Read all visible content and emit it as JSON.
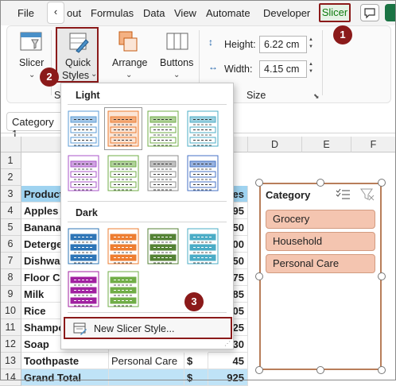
{
  "menu": {
    "file": "File",
    "back": "‹",
    "partial_tab": "out",
    "formulas": "Formulas",
    "data": "Data",
    "view": "View",
    "automate": "Automate",
    "developer": "Developer",
    "slicer": "Slicer"
  },
  "ribbon": {
    "slicer_label": "Slicer",
    "quick_styles_line1": "Quick",
    "quick_styles_line2": "Styles",
    "arrange_label": "Arrange",
    "buttons_label": "Buttons",
    "height_label": "Height:",
    "height_value": "6.22 cm",
    "width_label": "Width:",
    "width_value": "4.15 cm",
    "size_group": "Size",
    "group_partial": "S"
  },
  "callouts": [
    "1",
    "2",
    "3"
  ],
  "namebox": "Category 1",
  "columns": [
    "D",
    "E",
    "F"
  ],
  "rows": [
    "1",
    "2",
    "3",
    "4",
    "5",
    "6",
    "7",
    "8",
    "9",
    "10",
    "11",
    "12",
    "13",
    "14"
  ],
  "sheet": {
    "header": "Product",
    "header_right": "les",
    "cells": [
      {
        "row": "4",
        "a": "Apples",
        "v": "95"
      },
      {
        "row": "5",
        "a": "Bananas",
        "v": "50"
      },
      {
        "row": "6",
        "a": "Deterge",
        "v": "00"
      },
      {
        "row": "7",
        "a": "Dishwas",
        "v": "50"
      },
      {
        "row": "8",
        "a": "Floor Cl",
        "v": "75"
      },
      {
        "row": "9",
        "a": "Milk",
        "v": "85"
      },
      {
        "row": "10",
        "a": "Rice",
        "v": "05"
      },
      {
        "row": "11",
        "a": "Shampo",
        "v": "25"
      },
      {
        "row": "12",
        "a": "Soap",
        "v": "30"
      },
      {
        "row": "13",
        "a": "Toothpaste",
        "b": "Personal Care",
        "c": "$",
        "v": "45"
      }
    ],
    "total_label": "Grand Total",
    "total_currency": "$",
    "total_value": "925"
  },
  "dropdown": {
    "light_label": "Light",
    "dark_label": "Dark",
    "new_style_label": "New Slicer Style...",
    "light_colors": [
      "#5b9bd5",
      "#ed7d31",
      "#70ad47",
      "#4bacc6",
      "#a855c8",
      "#70ad47",
      "#8c8c8c",
      "#4472c4"
    ],
    "dark_colors": [
      "#2e75b6",
      "#ed7d31",
      "#548235",
      "#4bacc6",
      "#a020a0",
      "#70ad47"
    ]
  },
  "slicer": {
    "title": "Category",
    "items": [
      "Grocery",
      "Household",
      "Personal Care"
    ]
  },
  "colors": {
    "accent": "#8b1a1a",
    "header_fill": "#9fd3f0",
    "slicer_item": "#f4c5b0",
    "slicer_border": "#b87e5a"
  }
}
